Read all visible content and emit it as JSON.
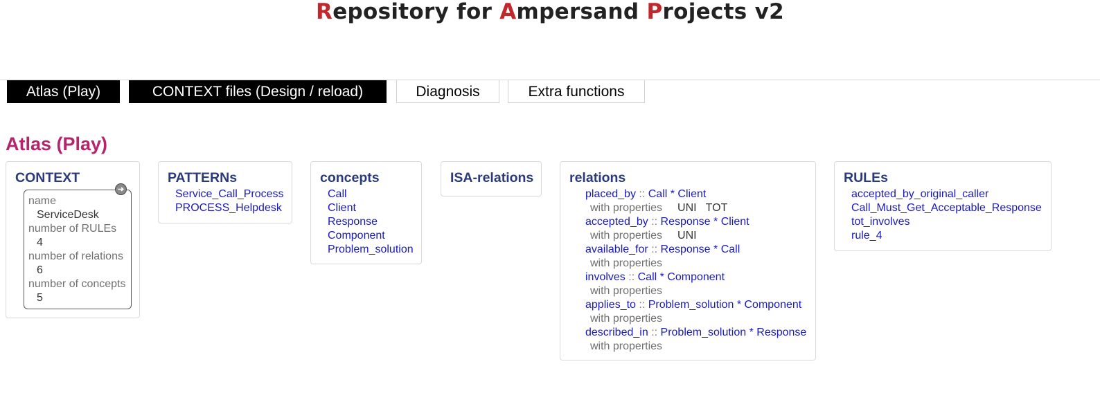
{
  "app_title": {
    "letters": [
      "R",
      "A",
      "P"
    ],
    "parts": [
      "epository for ",
      "mpersand ",
      "rojects v2"
    ]
  },
  "tabs": [
    {
      "label": "Atlas (Play)",
      "active": true
    },
    {
      "label": "CONTEXT files (Design / reload)",
      "active": true
    },
    {
      "label": "Diagnosis",
      "active": false
    },
    {
      "label": "Extra functions",
      "active": false
    }
  ],
  "section_title": "Atlas (Play)",
  "context": {
    "title": "CONTEXT",
    "name_label": "name",
    "name_value": "ServiceDesk",
    "rules_label": "number of RULEs",
    "rules_value": "4",
    "relations_label": "number of relations",
    "relations_value": "6",
    "concepts_label": "number of concepts",
    "concepts_value": "5"
  },
  "patterns": {
    "title": "PATTERNs",
    "items": [
      "Service_Call_Process",
      "PROCESS_Helpdesk"
    ]
  },
  "concepts": {
    "title": "concepts",
    "items": [
      "Call",
      "Client",
      "Response",
      "Component",
      "Problem_solution"
    ]
  },
  "isa": {
    "title": "ISA-relations"
  },
  "relations": {
    "title": "relations",
    "separator": "::",
    "properties_label": "with properties",
    "items": [
      {
        "name": "placed_by",
        "signature": "Call * Client",
        "properties": "UNI   TOT"
      },
      {
        "name": "accepted_by",
        "signature": "Response * Client",
        "properties": "UNI"
      },
      {
        "name": "available_for",
        "signature": "Response * Call",
        "properties": ""
      },
      {
        "name": "involves",
        "signature": "Call * Component",
        "properties": ""
      },
      {
        "name": "applies_to",
        "signature": "Problem_solution * Component",
        "properties": ""
      },
      {
        "name": "described_in",
        "signature": "Problem_solution * Response",
        "properties": ""
      }
    ]
  },
  "rules": {
    "title": "RULEs",
    "items": [
      "accepted_by_original_caller",
      "Call_Must_Get_Acceptable_Response",
      "tot_involves",
      "rule_4"
    ]
  },
  "colors": {
    "title_accent": "#c0282b",
    "section_title": "#b5256b",
    "card_title": "#2a3a7a",
    "link": "#1a1ab8",
    "tab_active_bg": "#000000"
  }
}
